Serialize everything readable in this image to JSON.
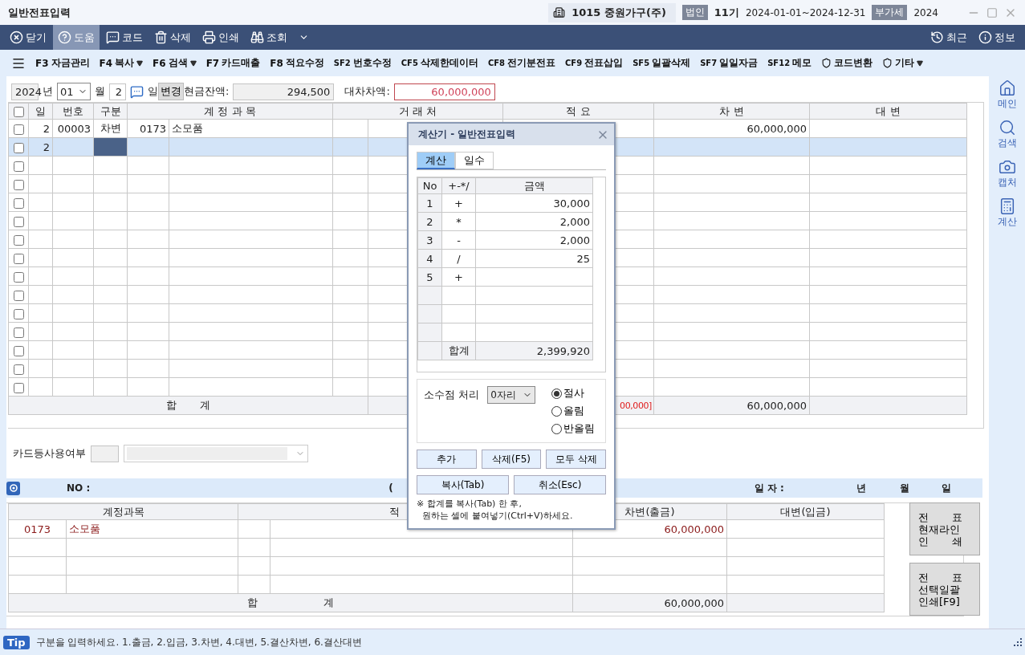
{
  "window": {
    "title": "일반전표입력",
    "company": "1015 중원가구(주)",
    "badges": [
      {
        "label": "법인",
        "value": "11기"
      },
      {
        "label": "부가세",
        "value": "2024"
      }
    ],
    "period": "2024-01-01~2024-12-31"
  },
  "toolbar": {
    "left": [
      {
        "label": "닫기",
        "selected": false
      },
      {
        "label": "도움",
        "selected": true
      },
      {
        "label": "코드",
        "selected": false
      },
      {
        "label": "삭제",
        "selected": false
      },
      {
        "label": "인쇄",
        "selected": false
      },
      {
        "label": "조회",
        "selected": false
      }
    ],
    "right": [
      {
        "label": "최근"
      },
      {
        "label": "정보"
      }
    ]
  },
  "function_bar": [
    {
      "key": "F3",
      "label": "자금관리",
      "dropdown": false
    },
    {
      "key": "F4",
      "label": "복사",
      "dropdown": true
    },
    {
      "key": "F6",
      "label": "검색",
      "dropdown": true
    },
    {
      "key": "F7",
      "label": "카드매출",
      "dropdown": false
    },
    {
      "key": "F8",
      "label": "적요수정",
      "dropdown": false
    },
    {
      "key": "SF2",
      "label": "번호수정",
      "dropdown": false
    },
    {
      "key": "CF5",
      "label": "삭제한데이터",
      "dropdown": false
    },
    {
      "key": "CF8",
      "label": "전기분전표",
      "dropdown": false
    },
    {
      "key": "CF9",
      "label": "전표삽입",
      "dropdown": false
    },
    {
      "key": "SF5",
      "label": "일괄삭제",
      "dropdown": false
    },
    {
      "key": "SF7",
      "label": "일일자금",
      "dropdown": false
    },
    {
      "key": "SF12",
      "label": "메모",
      "dropdown": false
    },
    {
      "label": "코드변환",
      "dropdown": false,
      "badge": true
    },
    {
      "label": "기타",
      "dropdown": true,
      "badge": true
    }
  ],
  "date_row": {
    "year": "2024",
    "year_label": "년",
    "month": "01",
    "month_label": "월",
    "day": "2",
    "day_label": "일",
    "change_button": "변경",
    "cash_label": "현금잔액:",
    "cash": "294,500",
    "diff_label": "대차차액:",
    "diff": "60,000,000"
  },
  "journal": {
    "header_checked": false,
    "columns": [
      "일",
      "번호",
      "구분",
      "계 정 과 목",
      "거 래 처",
      "적 요",
      "차 변",
      "대 변"
    ],
    "rows": [
      {
        "checked": false,
        "selected": false,
        "day": "2",
        "no": "00003",
        "type": "차변",
        "code": "0173",
        "account": "소모품",
        "debit": "60,000,000"
      },
      {
        "checked": false,
        "selected": true,
        "day": "2"
      },
      {
        "checked": false,
        "selected": false
      },
      {
        "checked": false,
        "selected": false
      },
      {
        "checked": false,
        "selected": false
      },
      {
        "checked": false,
        "selected": false
      },
      {
        "checked": false,
        "selected": false
      },
      {
        "checked": false,
        "selected": false
      },
      {
        "checked": false,
        "selected": false
      },
      {
        "checked": false,
        "selected": false
      },
      {
        "checked": false,
        "selected": false
      },
      {
        "checked": false,
        "selected": false
      },
      {
        "checked": false,
        "selected": false
      },
      {
        "checked": false,
        "selected": false
      },
      {
        "checked": false,
        "selected": false
      }
    ],
    "total_label": "합       계",
    "total_diff": "00,000]",
    "total_debit": "60,000,000"
  },
  "card_use": {
    "label": "카드등사용여부"
  },
  "info_bar": {
    "no_label": "NO :",
    "paren": "(",
    "date_label": "일 자 :",
    "year": "년",
    "month": "월",
    "day": "일"
  },
  "voucher": {
    "columns": [
      "계정과목",
      "적",
      "차변(출금)",
      "대변(입금)"
    ],
    "rows": [
      {
        "code": "0173",
        "account": "소모품",
        "debit": "60,000,000"
      },
      {},
      {},
      {}
    ],
    "total_label": "합                    계",
    "total_debit": "60,000,000"
  },
  "side_buttons": [
    "전       표\n현재라인\n인       쇄",
    "전       표\n선택일괄\n인쇄[F9]"
  ],
  "sidebar": [
    {
      "label": "메인"
    },
    {
      "label": "검색"
    },
    {
      "label": "캡처"
    },
    {
      "label": "계산"
    }
  ],
  "calculator": {
    "title": "계산기 - 일반전표입력",
    "tabs": [
      {
        "label": "계산",
        "selected": true
      },
      {
        "label": "일수",
        "selected": false
      }
    ],
    "columns": [
      "No",
      "+-*/",
      "금액"
    ],
    "rows": [
      {
        "no": "1",
        "op": "+",
        "amount": "30,000"
      },
      {
        "no": "2",
        "op": "*",
        "amount": "2,000"
      },
      {
        "no": "3",
        "op": "-",
        "amount": "2,000"
      },
      {
        "no": "4",
        "op": "/",
        "amount": "25"
      },
      {
        "no": "5",
        "op": "+"
      },
      {},
      {},
      {}
    ],
    "total_label": "합계",
    "total": "2,399,920",
    "decimal_label": "소수점 처리",
    "decimal_value": "0자리",
    "rounding": [
      {
        "label": "절사",
        "selected": true
      },
      {
        "label": "올림",
        "selected": false
      },
      {
        "label": "반올림",
        "selected": false
      }
    ],
    "buttons": [
      "추가",
      "삭제(F5)",
      "모두 삭제"
    ],
    "buttons2": [
      "복사(Tab)",
      "취소(Esc)"
    ],
    "note": "※ 합계를 복사(Tab) 한 후,\n  원하는 셀에 붙여넣기(Ctrl+V)하세요."
  },
  "status_bar": {
    "tip": "Tip",
    "text": "구분을 입력하세요. 1.출금, 2.입금, 3.차변, 4.대변, 5.결산차변, 6.결산대변"
  }
}
